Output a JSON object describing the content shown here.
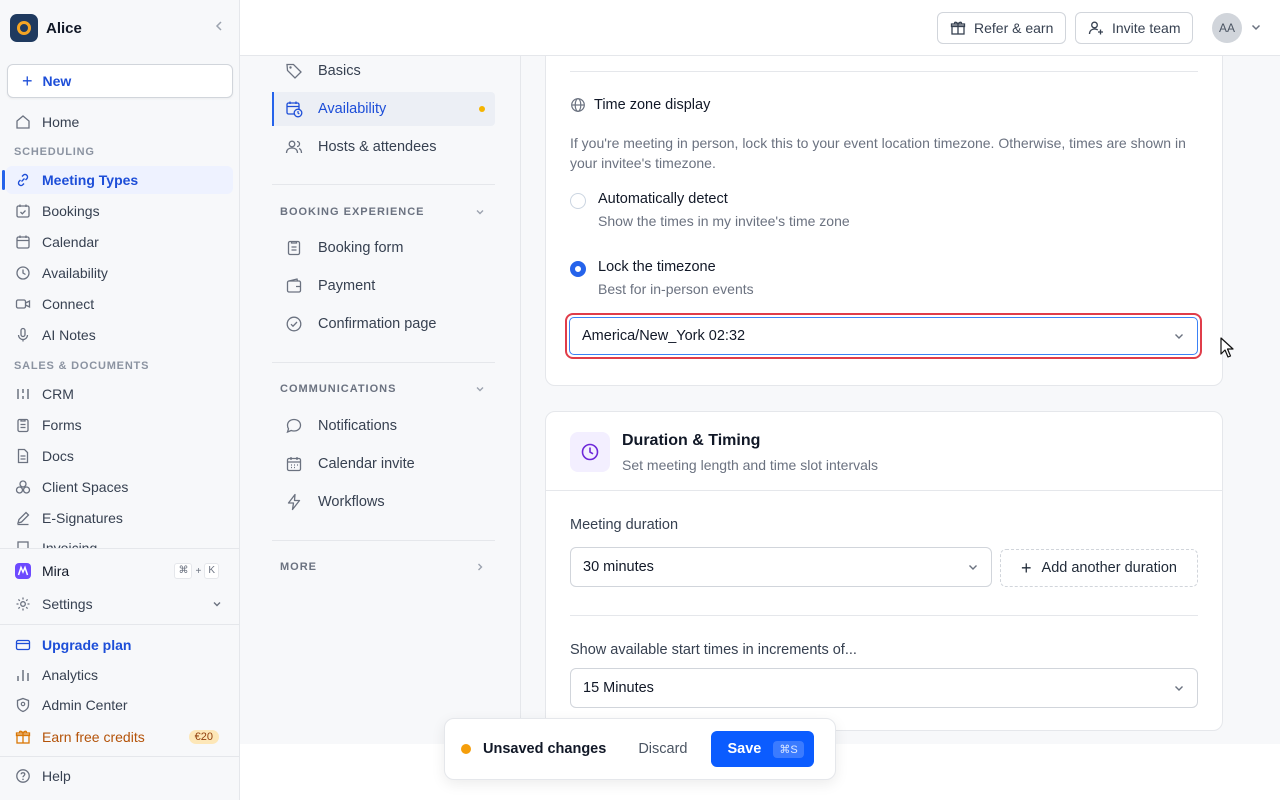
{
  "sidebar": {
    "workspace": "Alice",
    "new_label": "New",
    "home": "Home",
    "section_scheduling": "SCHEDULING",
    "scheduling_items": [
      "Meeting Types",
      "Bookings",
      "Calendar",
      "Availability",
      "Connect",
      "AI Notes"
    ],
    "section_sales": "SALES & DOCUMENTS",
    "sales_items": [
      "CRM",
      "Forms",
      "Docs",
      "Client Spaces",
      "E-Signatures",
      "Invoicing"
    ],
    "mira": "Mira",
    "mira_shortcut": [
      "⌘",
      "+",
      "K"
    ],
    "settings": "Settings",
    "upgrade": "Upgrade plan",
    "analytics": "Analytics",
    "admin": "Admin Center",
    "earn": "Earn free credits",
    "earn_badge": "€20",
    "help": "Help"
  },
  "topbar": {
    "refer": "Refer & earn",
    "invite": "Invite team",
    "avatar_initials": "AA"
  },
  "midnav": {
    "items_top": [
      "Basics",
      "Availability",
      "Hosts & attendees"
    ],
    "section_booking": "BOOKING EXPERIENCE",
    "booking_items": [
      "Booking form",
      "Payment",
      "Confirmation page"
    ],
    "section_comms": "COMMUNICATIONS",
    "comms_items": [
      "Notifications",
      "Calendar invite",
      "Workflows"
    ],
    "section_more": "MORE"
  },
  "timezone": {
    "title": "Time zone display",
    "description": "If you're meeting in person, lock this to your event location timezone. Otherwise, times are shown in your invitee's timezone.",
    "option_auto_title": "Automatically detect",
    "option_auto_sub": "Show the times in my invitee's time zone",
    "option_lock_title": "Lock the timezone",
    "option_lock_sub": "Best for in-person events",
    "selected": "America/New_York 02:32"
  },
  "duration": {
    "title": "Duration & Timing",
    "subtitle": "Set meeting length and time slot intervals",
    "meeting_label": "Meeting duration",
    "meeting_value": "30 minutes",
    "add_another": "Add another duration",
    "increment_label": "Show available start times in increments of...",
    "increment_value": "15 Minutes"
  },
  "savebar": {
    "status": "Unsaved changes",
    "discard": "Discard",
    "save": "Save",
    "shortcut": "⌘S"
  },
  "colors": {
    "accent": "#2563eb",
    "save_button": "#0b5cff",
    "highlight_border": "#e03d4a",
    "warning_dot": "#f59e0b"
  }
}
